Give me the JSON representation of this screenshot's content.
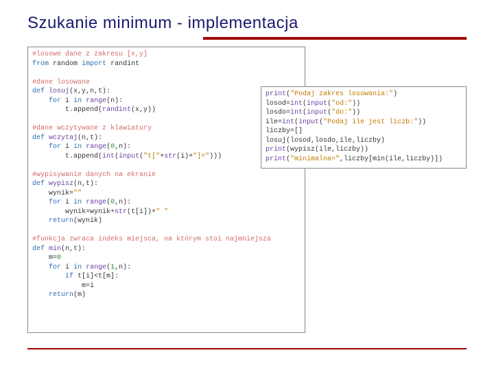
{
  "title": "Szukanie minimum - implementacja",
  "left_code": {
    "c1": "#losowe dane z zakresu [x,y]",
    "l1a": "from",
    "l1b": "random",
    "l1c": "import",
    "l1d": "randint",
    "c2": "#dane losowane",
    "l2a": "def",
    "l2b": "losuj",
    "l2c": "(x,y,n,t):",
    "l3a": "for",
    "l3b": "i",
    "l3c": "in",
    "l3d": "range",
    "l3e": "(n):",
    "l4a": "t.append(",
    "l4b": "randint",
    "l4c": "(x,y))",
    "c3": "#dane wczytywane z klawiatury",
    "l5a": "def",
    "l5b": "wczytaj",
    "l5c": "(n,t):",
    "l6a": "for",
    "l6b": "i",
    "l6c": "in",
    "l6d": "range",
    "l6e": "(",
    "l6f": "0",
    "l6g": ",n):",
    "l7a": "t.append(",
    "l7b": "int",
    "l7c": "(",
    "l7d": "input",
    "l7e": "(",
    "l7f": "\"t[\"",
    "l7g": "+",
    "l7h": "str",
    "l7i": "(i)+",
    "l7j": "\"]=\"",
    "l7k": ")))",
    "c4": "#wypisywanie danych na ekranie",
    "l8a": "def",
    "l8b": "wypisz",
    "l8c": "(n,t):",
    "l9a": "wynik=",
    "l9b": "\"\"",
    "l10a": "for",
    "l10b": "i",
    "l10c": "in",
    "l10d": "range",
    "l10e": "(",
    "l10f": "0",
    "l10g": ",n):",
    "l11a": "wynik=wynik+",
    "l11b": "str",
    "l11c": "(t[i])+",
    "l11d": "\" \"",
    "l12a": "return",
    "l12b": "(wynik)",
    "c5": "#funkcja zwraca indeks miejsca, na którym stoi najmniejsza",
    "l13a": "def",
    "l13b": "min",
    "l13c": "(n,t):",
    "l14a": "m=",
    "l14b": "0",
    "l15a": "for",
    "l15b": "i",
    "l15c": "in",
    "l15d": "range",
    "l15e": "(",
    "l15f": "1",
    "l15g": ",n):",
    "l16a": "if",
    "l16b": "t[i]<t[m]:",
    "l17a": "m=i",
    "l18a": "return",
    "l18b": "(m)"
  },
  "right_code": {
    "r1a": "print",
    "r1b": "(",
    "r1c": "\"Podaj zakres losowania:\"",
    "r1d": ")",
    "r2a": "losod=",
    "r2b": "int",
    "r2c": "(",
    "r2d": "input",
    "r2e": "(",
    "r2f": "\"od:\"",
    "r2g": "))",
    "r3a": "losdo=",
    "r3b": "int",
    "r3c": "(",
    "r3d": "input",
    "r3e": "(",
    "r3f": "\"do:\"",
    "r3g": "))",
    "r4a": "ile=",
    "r4b": "int",
    "r4c": "(",
    "r4d": "input",
    "r4e": "(",
    "r4f": "\"Podaj ile jest liczb:\"",
    "r4g": "))",
    "r5a": "liczby=[]",
    "r6a": "losuj(losod,losdo,ile,liczby)",
    "r7a": "print",
    "r7b": "(wypisz(ile,liczby))",
    "r8a": "print",
    "r8b": "(",
    "r8c": "\"minimalna=\"",
    "r8d": ",liczby[min(ile,liczby)])"
  }
}
